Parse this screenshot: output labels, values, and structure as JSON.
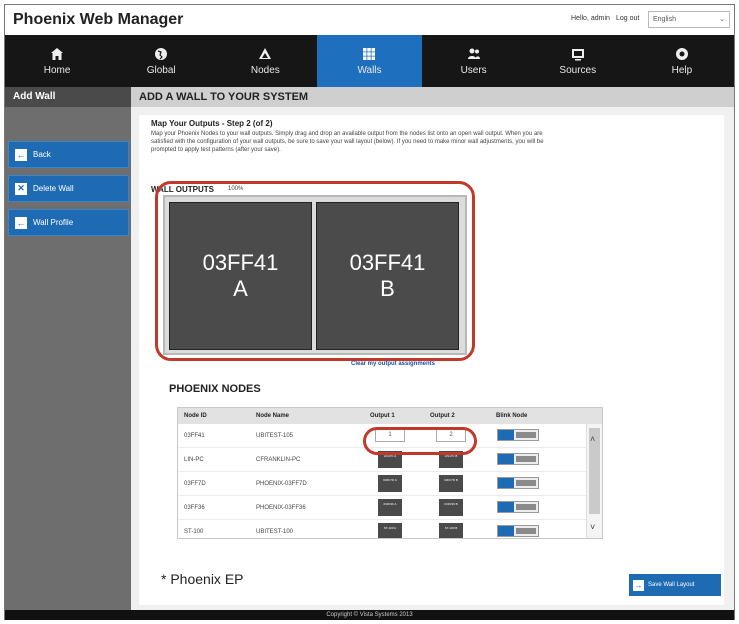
{
  "app": {
    "title": "Phoenix Web Manager",
    "greeting": "Hello, admin",
    "logout_label": "Log out",
    "language": "English"
  },
  "nav": {
    "items": [
      {
        "label": "Home",
        "icon": "home-icon"
      },
      {
        "label": "Global",
        "icon": "globe-icon"
      },
      {
        "label": "Nodes",
        "icon": "nodes-icon"
      },
      {
        "label": "Walls",
        "icon": "walls-grid-icon"
      },
      {
        "label": "Users",
        "icon": "users-icon"
      },
      {
        "label": "Sources",
        "icon": "sources-icon"
      },
      {
        "label": "Help",
        "icon": "help-icon"
      }
    ],
    "active": "Walls",
    "active_color": "#1e6fbe"
  },
  "sidebar": {
    "header": "Add Wall",
    "buttons": [
      {
        "label": "Back",
        "icon": "arrow-left-icon"
      },
      {
        "label": "Delete Wall",
        "icon": "close-x-icon"
      },
      {
        "label": "Wall Profile",
        "icon": "arrow-left-icon"
      }
    ],
    "button_color": "#1f6bb3"
  },
  "page": {
    "header": "ADD A WALL TO YOUR SYSTEM",
    "step_title": "Map Your Outputs - Step 2 (of 2)",
    "step_desc": "Map your Phoenix Nodes to your wall outputs. Simply drag and drop an available output from the nodes list onto an open wall output. When you are satisfied with the configuration of your wall outputs, be sure to save your wall layout (below). If you need to make minor wall adjustments, you will be prompted to apply test patterns (after your save).",
    "wall_outputs_label": "WALL OUTPUTS",
    "zoom": "100%",
    "wall_outputs": [
      {
        "node": "03FF41",
        "port": "A"
      },
      {
        "node": "03FF41",
        "port": "B"
      }
    ],
    "clear_link": "Clear my output assignments",
    "nodes_title": "PHOENIX NODES",
    "table": {
      "headers": [
        "Node ID",
        "Node Name",
        "Output 1",
        "Output 2",
        "Blink Node"
      ],
      "rows": [
        {
          "id": "03FF41",
          "name": "UBITEST-105",
          "out1": "1",
          "out2": "2",
          "mapped": true
        },
        {
          "id": "LIN-PC",
          "name": "CFRANKLIN-PC",
          "out1": "LIN-PC A",
          "out2": "LIN-PC B",
          "mapped": false
        },
        {
          "id": "03FF7D",
          "name": "PHOENIX-03FF7D",
          "out1": "03FF7D A",
          "out2": "03FF7D B",
          "mapped": false
        },
        {
          "id": "03FF36",
          "name": "PHOENIX-03FF36",
          "out1": "03FF36 A",
          "out2": "03FF36 B",
          "mapped": false
        },
        {
          "id": "ST-100",
          "name": "UBITEST-100",
          "out1": "ST-100 A",
          "out2": "ST-100 B",
          "mapped": false
        }
      ]
    },
    "note": "* Phoenix EP",
    "save_label": "Save Wall Layout",
    "highlight_color": "#c0392b"
  },
  "footer": "Copyright © Vista Systems 2013"
}
